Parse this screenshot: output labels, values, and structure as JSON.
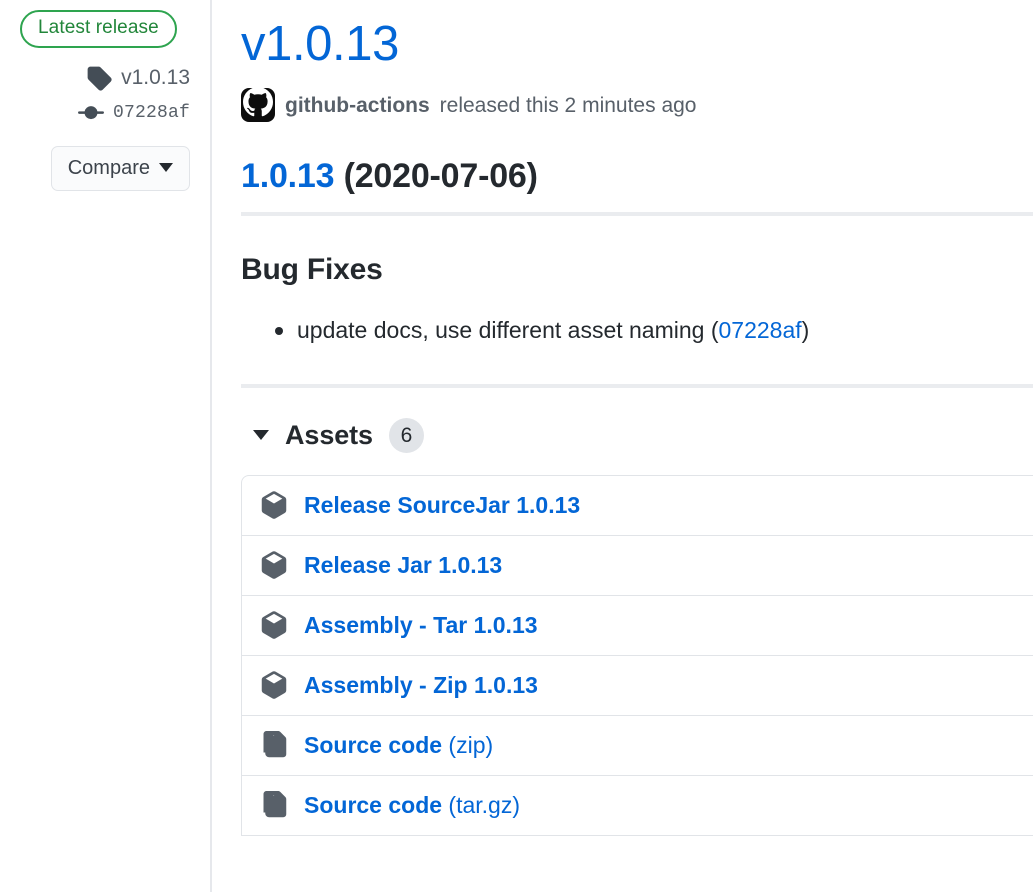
{
  "sidebar": {
    "latest_badge": "Latest release",
    "tag": {
      "icon": "tag-icon",
      "label": "v1.0.13"
    },
    "commit": {
      "icon": "git-commit-icon",
      "label": "07228af"
    },
    "compare_button": "Compare"
  },
  "release": {
    "title": "v1.0.13",
    "author": "github-actions",
    "published_text": "released this 2 minutes ago",
    "avatar_icon": "github-mark-icon"
  },
  "body": {
    "heading_link": "1.0.13",
    "heading_date": "(2020-07-06)",
    "subheading": "Bug Fixes",
    "bullets": [
      {
        "text": "update docs, use different asset naming (",
        "link": "07228af",
        "text_after": ")"
      }
    ]
  },
  "assets": {
    "label": "Assets",
    "count": "6",
    "expanded": true,
    "items": [
      {
        "icon": "package-icon",
        "name": "Release SourceJar 1.0.13",
        "suffix": ""
      },
      {
        "icon": "package-icon",
        "name": "Release Jar 1.0.13",
        "suffix": ""
      },
      {
        "icon": "package-icon",
        "name": "Assembly - Tar 1.0.13",
        "suffix": ""
      },
      {
        "icon": "package-icon",
        "name": "Assembly - Zip 1.0.13",
        "suffix": ""
      },
      {
        "icon": "file-zip-icon",
        "name": "Source code",
        "suffix": " (zip)"
      },
      {
        "icon": "file-zip-icon",
        "name": "Source code",
        "suffix": " (tar.gz)"
      }
    ]
  },
  "colors": {
    "link_blue": "#0366d6",
    "badge_green": "#2ea44f",
    "text_dark": "#24292e",
    "text_muted": "#586069",
    "border": "#e1e4e8"
  }
}
